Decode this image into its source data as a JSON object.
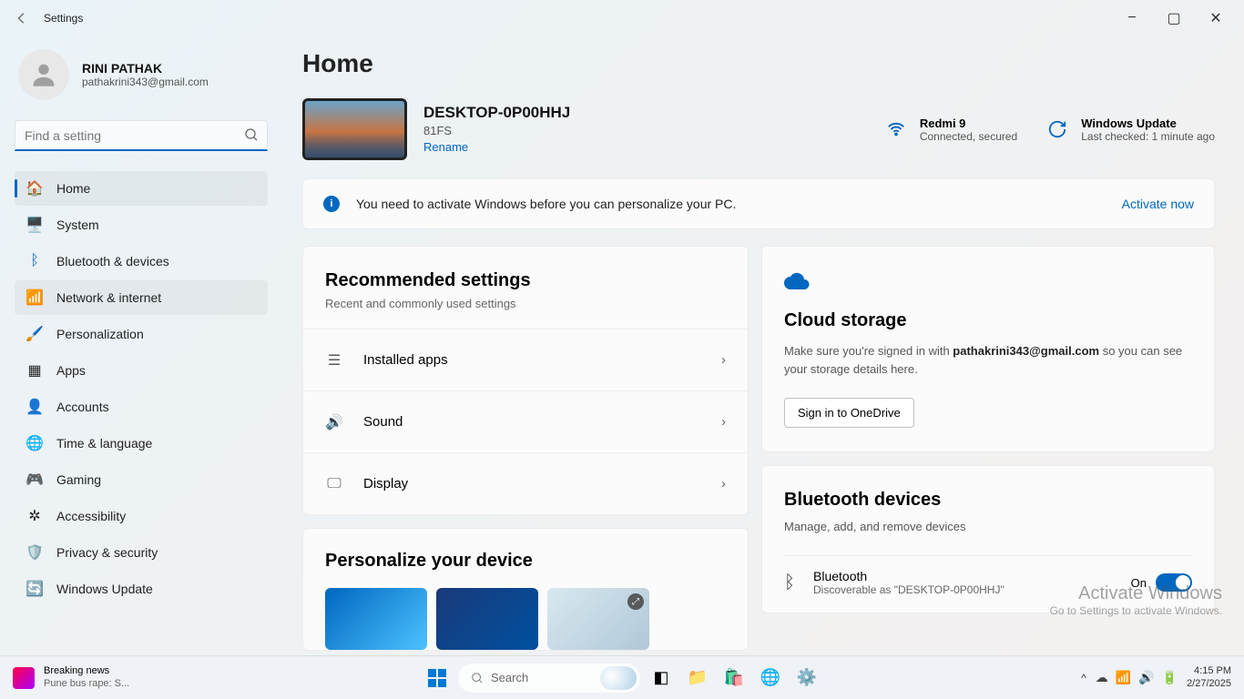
{
  "app_title": "Settings",
  "window_controls": {
    "min": "−",
    "max": "▢",
    "close": "✕"
  },
  "profile": {
    "name": "RINI PATHAK",
    "email": "pathakrini343@gmail.com"
  },
  "search": {
    "placeholder": "Find a setting"
  },
  "nav": {
    "items": [
      {
        "label": "Home",
        "icon": "🏠",
        "selected": true
      },
      {
        "label": "System",
        "icon": "🖥️"
      },
      {
        "label": "Bluetooth & devices",
        "icon": "ᛒ",
        "icon_color": "#0067c0"
      },
      {
        "label": "Network & internet",
        "icon": "📶",
        "hover": true
      },
      {
        "label": "Personalization",
        "icon": "🖌️"
      },
      {
        "label": "Apps",
        "icon": "▦"
      },
      {
        "label": "Accounts",
        "icon": "👤"
      },
      {
        "label": "Time & language",
        "icon": "🌐"
      },
      {
        "label": "Gaming",
        "icon": "🎮"
      },
      {
        "label": "Accessibility",
        "icon": "✲"
      },
      {
        "label": "Privacy & security",
        "icon": "🛡️"
      },
      {
        "label": "Windows Update",
        "icon": "🔄"
      }
    ]
  },
  "page": {
    "title": "Home"
  },
  "device": {
    "name": "DESKTOP-0P00HHJ",
    "model": "81FS",
    "rename": "Rename"
  },
  "status": {
    "wifi": {
      "title": "Redmi 9",
      "sub": "Connected, secured"
    },
    "update": {
      "title": "Windows Update",
      "sub": "Last checked: 1 minute ago"
    }
  },
  "activation": {
    "msg": "You need to activate Windows before you can personalize your PC.",
    "action": "Activate now"
  },
  "recommended": {
    "title": "Recommended settings",
    "sub": "Recent and commonly used settings",
    "items": [
      {
        "label": "Installed apps"
      },
      {
        "label": "Sound"
      },
      {
        "label": "Display"
      }
    ]
  },
  "cloud": {
    "title": "Cloud storage",
    "desc_pre": "Make sure you're signed in with ",
    "desc_email": "pathakrini343@gmail.com",
    "desc_post": " so you can see your storage details here.",
    "button": "Sign in to OneDrive"
  },
  "bluetooth": {
    "title": "Bluetooth devices",
    "sub": "Manage, add, and remove devices",
    "row_title": "Bluetooth",
    "row_sub": "Discoverable as \"DESKTOP-0P00HHJ\"",
    "toggle_label": "On"
  },
  "personalize": {
    "title": "Personalize your device"
  },
  "watermark": {
    "l1": "Activate Windows",
    "l2": "Go to Settings to activate Windows."
  },
  "taskbar": {
    "news_title": "Breaking news",
    "news_sub": "Pune bus rape: S...",
    "search_placeholder": "Search",
    "time": "4:15 PM",
    "date": "2/27/2025"
  }
}
